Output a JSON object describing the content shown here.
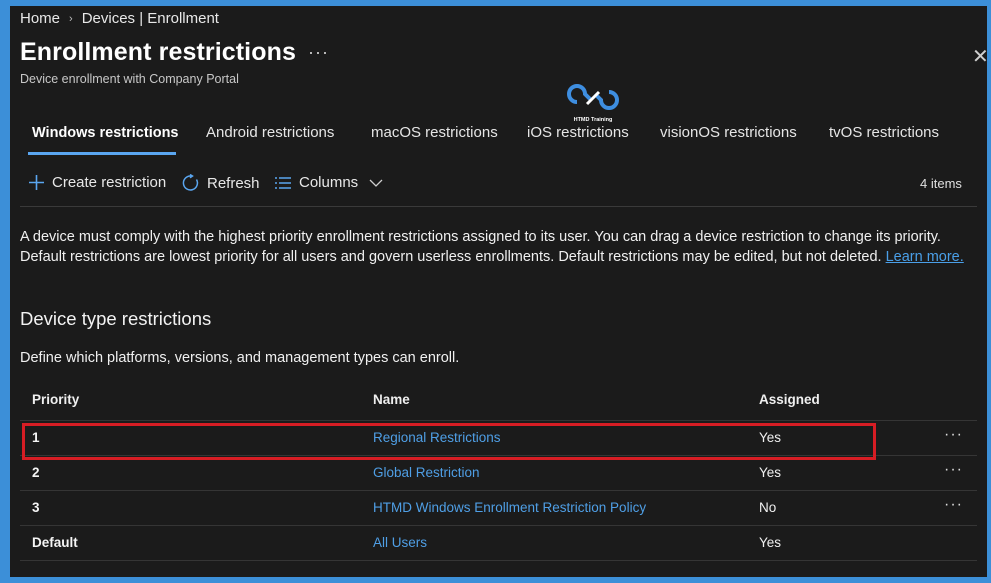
{
  "breadcrumb": {
    "home": "Home",
    "separator": "›",
    "section": "Devices | Enrollment"
  },
  "header": {
    "title": "Enrollment restrictions",
    "more": "···",
    "subtitle": "Device enrollment with Company Portal",
    "close": "✕"
  },
  "logo": {
    "text": "HTMD Training"
  },
  "tabs": [
    {
      "label": "Windows restrictions",
      "active": true
    },
    {
      "label": "Android restrictions"
    },
    {
      "label": "macOS restrictions"
    },
    {
      "label": "iOS restrictions"
    },
    {
      "label": "visionOS restrictions"
    },
    {
      "label": "tvOS restrictions"
    }
  ],
  "toolbar": {
    "create": "Create restriction",
    "refresh": "Refresh",
    "columns": "Columns",
    "count": "4 items"
  },
  "description": {
    "text": "A device must comply with the highest priority enrollment restrictions assigned to its user. You can drag a device restriction to change its priority. Default restrictions are lowest priority for all users and govern userless enrollments. Default restrictions may be edited, but not deleted. ",
    "link": "Learn more."
  },
  "section": {
    "title": "Device type restrictions",
    "description": "Define which platforms, versions, and management types can enroll."
  },
  "table": {
    "columns": [
      "Priority",
      "Name",
      "Assigned"
    ],
    "rows": [
      {
        "priority": "1",
        "name": "Regional Restrictions",
        "assigned": "Yes",
        "more": "···"
      },
      {
        "priority": "2",
        "name": "Global Restriction",
        "assigned": "Yes",
        "more": "···"
      },
      {
        "priority": "3",
        "name": "HTMD Windows Enrollment Restriction Policy",
        "assigned": "No",
        "more": "···"
      },
      {
        "priority": "Default",
        "name": "All Users",
        "assigned": "Yes",
        "more": ""
      }
    ]
  },
  "colors": {
    "accent": "#5aa6f0",
    "link": "#4f9fe6",
    "highlight": "#d71d24",
    "background": "#1b1b1b",
    "border": "#3c8fd8"
  }
}
